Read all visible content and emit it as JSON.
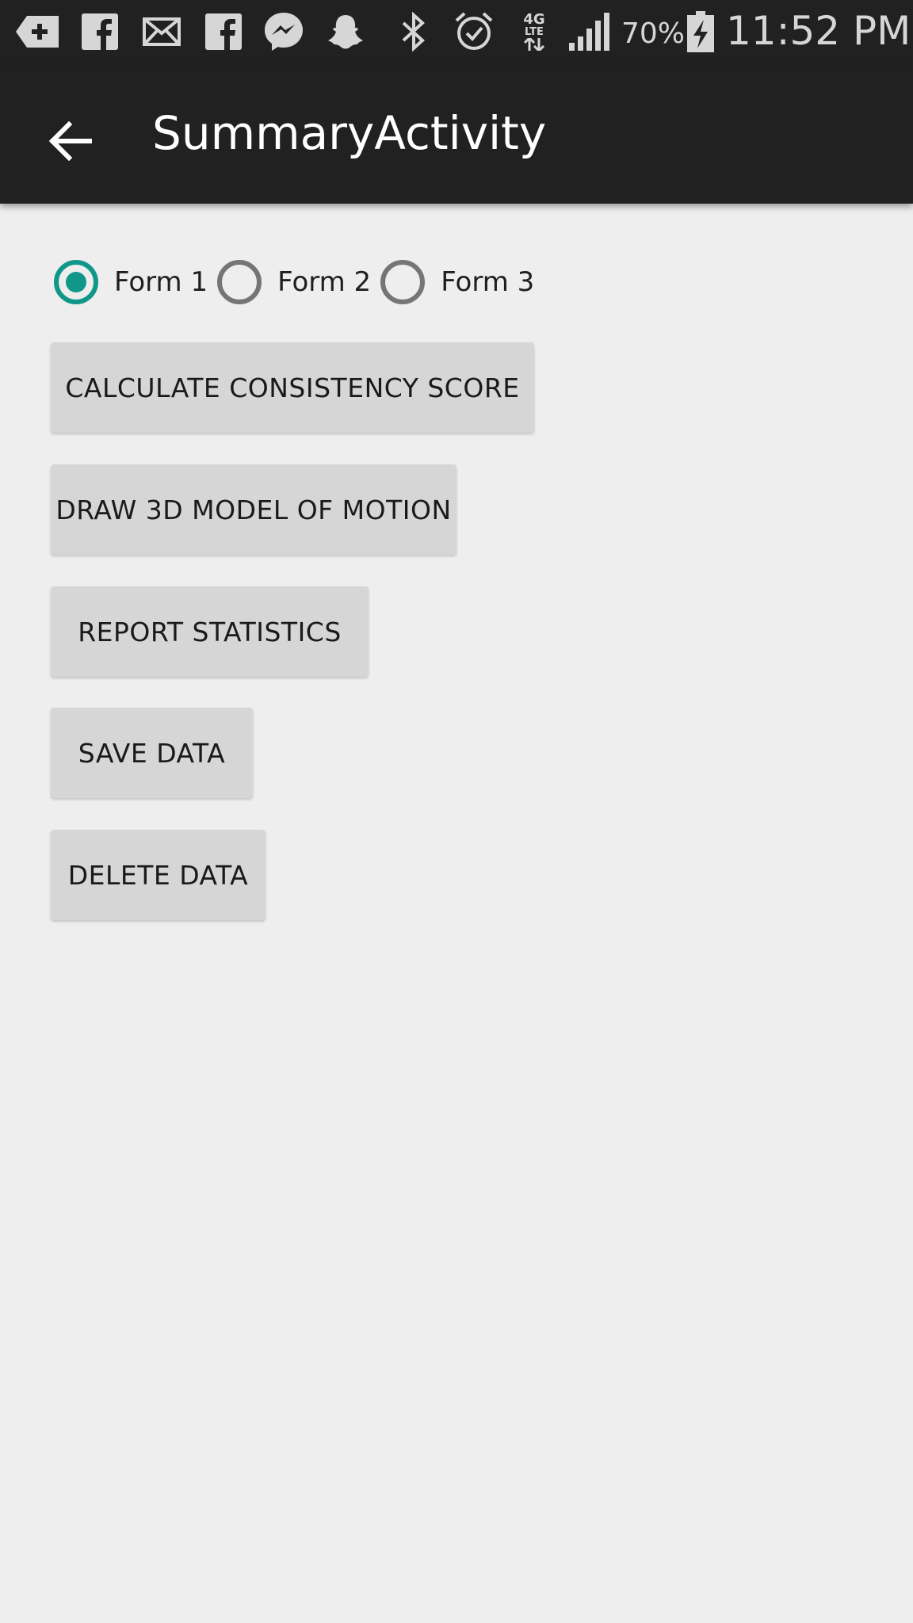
{
  "status_bar": {
    "icons": [
      "add-notification-icon",
      "facebook-icon",
      "mail-icon",
      "facebook-icon",
      "messenger-icon",
      "snapchat-icon",
      "bluetooth-icon",
      "alarm-icon",
      "4g-lte-icon",
      "signal-icon"
    ],
    "network_label": "4G",
    "network_sub": "LTE",
    "battery_percent": "70%",
    "time": "11:52 PM"
  },
  "toolbar": {
    "title": "SummaryActivity",
    "back_icon": "arrow-back-icon"
  },
  "radio_group": {
    "options": [
      {
        "label": "Form 1",
        "checked": true
      },
      {
        "label": "Form 2",
        "checked": false
      },
      {
        "label": "Form 3",
        "checked": false
      }
    ]
  },
  "buttons": {
    "calculate": "CALCULATE CONSISTENCY SCORE",
    "draw3d": "DRAW 3D MODEL OF MOTION",
    "report": "REPORT STATISTICS",
    "save": "SAVE DATA",
    "delete": "DELETE DATA"
  },
  "colors": {
    "accent": "#10978a",
    "toolbar": "#212121",
    "background": "#eeeeee",
    "button": "#d6d6d6"
  }
}
